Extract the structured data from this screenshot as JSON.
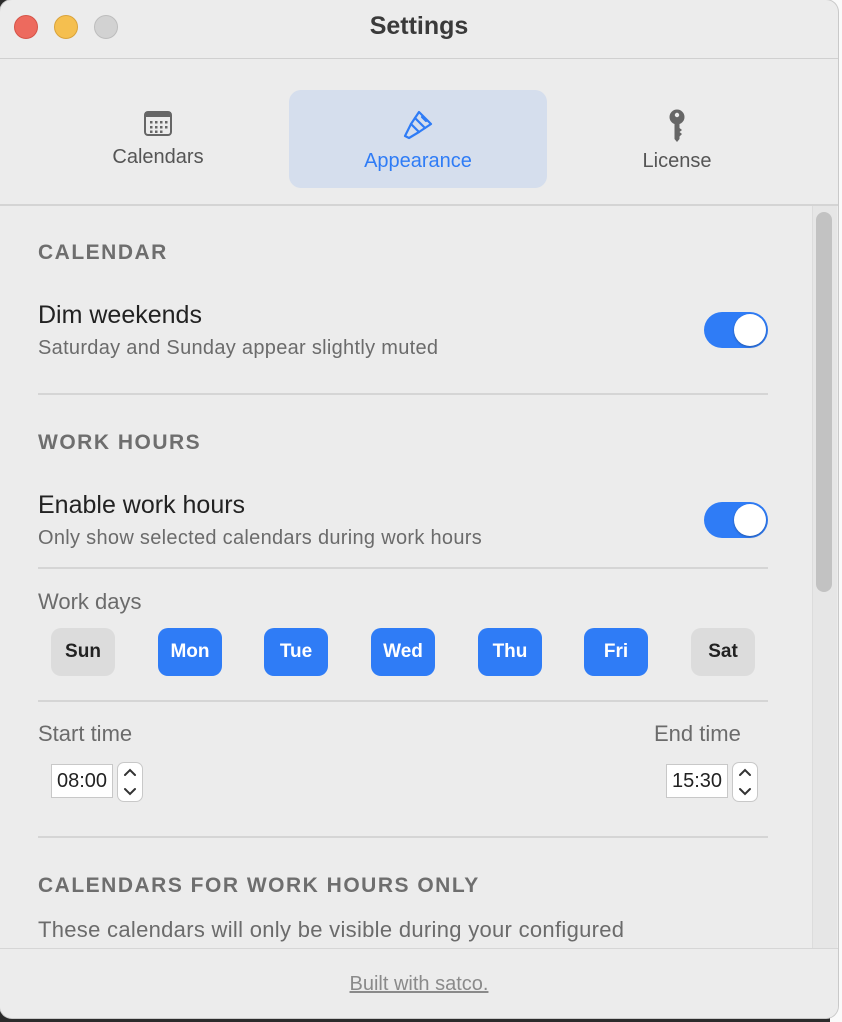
{
  "window": {
    "title": "Settings"
  },
  "tabs": [
    {
      "label": "Calendars",
      "icon": "calendar-icon",
      "active": false
    },
    {
      "label": "Appearance",
      "icon": "paintbrush-icon",
      "active": true
    },
    {
      "label": "License",
      "icon": "key-icon",
      "active": false
    }
  ],
  "calendar_section": {
    "title": "CALENDAR",
    "dim_weekends": {
      "title": "Dim weekends",
      "subtitle": "Saturday and Sunday appear slightly muted",
      "enabled": true
    }
  },
  "work_hours_section": {
    "title": "WORK HOURS",
    "enable": {
      "title": "Enable work hours",
      "subtitle": "Only show selected calendars during work hours",
      "enabled": true
    },
    "work_days_label": "Work days",
    "days": [
      {
        "label": "Sun",
        "selected": false
      },
      {
        "label": "Mon",
        "selected": true
      },
      {
        "label": "Tue",
        "selected": true
      },
      {
        "label": "Wed",
        "selected": true
      },
      {
        "label": "Thu",
        "selected": true
      },
      {
        "label": "Fri",
        "selected": true
      },
      {
        "label": "Sat",
        "selected": false
      }
    ],
    "start_time": {
      "label": "Start time",
      "value": "08:00"
    },
    "end_time": {
      "label": "End time",
      "value": "15:30"
    }
  },
  "work_hours_calendars_section": {
    "title": "CALENDARS FOR WORK HOURS ONLY",
    "description": "These calendars will only be visible during your configured"
  },
  "footer": {
    "link": "Built with satco."
  },
  "colors": {
    "accent": "#2f7cf6",
    "active_tab_bg": "#d5deed",
    "window_bg": "#ececec"
  }
}
